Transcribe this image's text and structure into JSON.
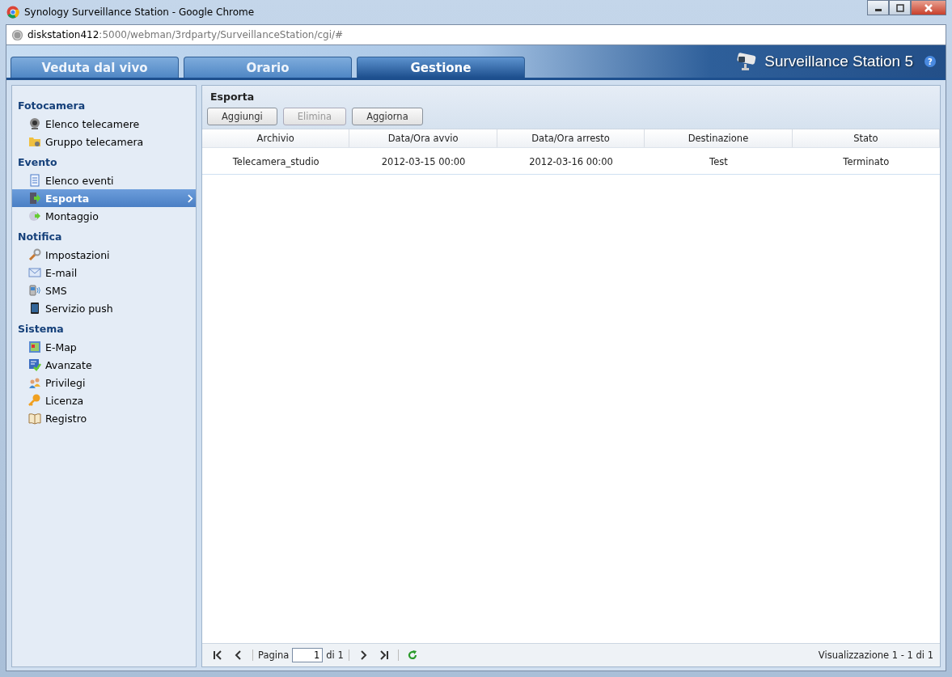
{
  "window": {
    "title": "Synology Surveillance Station - Google Chrome"
  },
  "address_bar": {
    "host": "diskstation412",
    "path": ":5000/webman/3rdparty/SurveillanceStation/cgi/#"
  },
  "tabs": [
    {
      "label": "Veduta dal vivo",
      "selected": false
    },
    {
      "label": "Orario",
      "selected": false
    },
    {
      "label": "Gestione",
      "selected": true
    }
  ],
  "app_title": "Surveillance Station 5",
  "help": "?",
  "sidebar": {
    "sections": [
      {
        "title": "Fotocamera",
        "items": [
          {
            "label": "Elenco telecamere",
            "selected": false
          },
          {
            "label": "Gruppo telecamera",
            "selected": false
          }
        ]
      },
      {
        "title": "Evento",
        "items": [
          {
            "label": "Elenco eventi",
            "selected": false
          },
          {
            "label": "Esporta",
            "selected": true
          },
          {
            "label": "Montaggio",
            "selected": false
          }
        ]
      },
      {
        "title": "Notifica",
        "items": [
          {
            "label": "Impostazioni",
            "selected": false
          },
          {
            "label": "E-mail",
            "selected": false
          },
          {
            "label": "SMS",
            "selected": false
          },
          {
            "label": "Servizio push",
            "selected": false
          }
        ]
      },
      {
        "title": "Sistema",
        "items": [
          {
            "label": "E-Map",
            "selected": false
          },
          {
            "label": "Avanzate",
            "selected": false
          },
          {
            "label": "Privilegi",
            "selected": false
          },
          {
            "label": "Licenza",
            "selected": false
          },
          {
            "label": "Registro",
            "selected": false
          }
        ]
      }
    ]
  },
  "panel": {
    "title": "Esporta",
    "buttons": [
      {
        "label": "Aggiungi",
        "disabled": false
      },
      {
        "label": "Elimina",
        "disabled": true
      },
      {
        "label": "Aggiorna",
        "disabled": false
      }
    ],
    "table": {
      "columns": [
        "Archivio",
        "Data/Ora avvio",
        "Data/Ora arresto",
        "Destinazione",
        "Stato"
      ],
      "rows": [
        [
          "Telecamera_studio",
          "2012-03-15 00:00",
          "2012-03-16 00:00",
          "Test",
          "Terminato"
        ]
      ]
    },
    "pager": {
      "page_label": "Pagina",
      "page": "1",
      "of": "di 1",
      "summary": "Visualizzazione 1 - 1 di 1"
    }
  }
}
